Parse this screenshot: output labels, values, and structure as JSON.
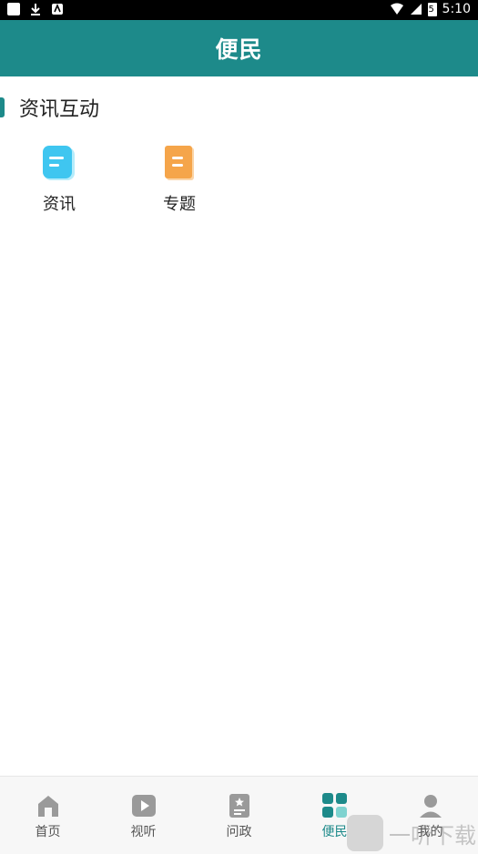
{
  "status_bar": {
    "time": "5:10",
    "battery_level": "5"
  },
  "header": {
    "title": "便民"
  },
  "section": {
    "title": "资讯互动"
  },
  "tiles": [
    {
      "label": "资讯",
      "icon": "news-icon",
      "color": "#3fc6f0"
    },
    {
      "label": "专题",
      "icon": "topic-icon",
      "color": "#f5a54a"
    }
  ],
  "tabs": [
    {
      "label": "首页",
      "icon": "home-icon",
      "active": false
    },
    {
      "label": "视听",
      "icon": "play-icon",
      "active": false
    },
    {
      "label": "问政",
      "icon": "inquiry-icon",
      "active": false
    },
    {
      "label": "便民",
      "icon": "grid-icon",
      "active": true
    },
    {
      "label": "我的",
      "icon": "user-icon",
      "active": false
    }
  ],
  "watermark": {
    "text": "一听下载"
  },
  "colors": {
    "accent": "#1d8a8a",
    "tab_inactive": "#9a9a9a"
  }
}
